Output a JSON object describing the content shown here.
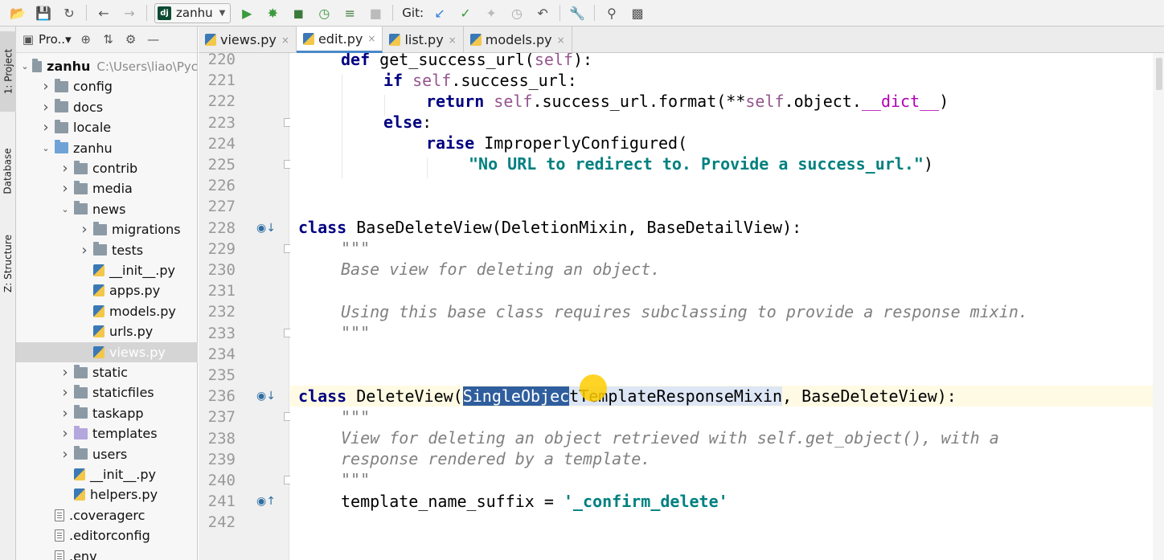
{
  "toolbar": {
    "run_config": "zanhu",
    "run_config_icon": "dj",
    "git_label": "Git:"
  },
  "left_tool_windows": [
    "1: Project",
    "Database",
    "Z: Structure"
  ],
  "project_panel": {
    "title": "Pro..▾",
    "tree": [
      {
        "label": "zanhu",
        "path": "C:\\Users\\liao\\Pyc",
        "type": "folder",
        "expanded": true,
        "bold": true
      },
      {
        "label": "config",
        "type": "folder",
        "expanded": false
      },
      {
        "label": "docs",
        "type": "folder",
        "expanded": false
      },
      {
        "label": "locale",
        "type": "folder",
        "expanded": false
      },
      {
        "label": "zanhu",
        "type": "folder-blue",
        "expanded": true
      },
      {
        "label": "contrib",
        "type": "folder",
        "expanded": false
      },
      {
        "label": "media",
        "type": "folder",
        "expanded": false
      },
      {
        "label": "news",
        "type": "folder",
        "expanded": true
      },
      {
        "label": "migrations",
        "type": "folder",
        "expanded": false
      },
      {
        "label": "tests",
        "type": "folder",
        "expanded": false
      },
      {
        "label": "__init__.py",
        "type": "py"
      },
      {
        "label": "apps.py",
        "type": "py"
      },
      {
        "label": "models.py",
        "type": "py"
      },
      {
        "label": "urls.py",
        "type": "py"
      },
      {
        "label": "views.py",
        "type": "py",
        "selected": true
      },
      {
        "label": "static",
        "type": "folder",
        "expanded": false
      },
      {
        "label": "staticfiles",
        "type": "folder",
        "expanded": false
      },
      {
        "label": "taskapp",
        "type": "folder",
        "expanded": false
      },
      {
        "label": "templates",
        "type": "folder-purple",
        "expanded": false
      },
      {
        "label": "users",
        "type": "folder",
        "expanded": false
      },
      {
        "label": "__init__.py",
        "type": "py"
      },
      {
        "label": "helpers.py",
        "type": "py"
      },
      {
        "label": ".coveragerc",
        "type": "cfg"
      },
      {
        "label": ".editorconfig",
        "type": "cfg"
      },
      {
        "label": ".env",
        "type": "cfg"
      }
    ]
  },
  "tabs": [
    {
      "label": "views.py",
      "active": false
    },
    {
      "label": "edit.py",
      "active": true
    },
    {
      "label": "list.py",
      "active": false
    },
    {
      "label": "models.py",
      "active": false
    }
  ],
  "editor": {
    "line_numbers": [
      "220",
      "221",
      "222",
      "223",
      "224",
      "225",
      "226",
      "227",
      "228",
      "229",
      "230",
      "231",
      "232",
      "233",
      "234",
      "235",
      "236",
      "237",
      "238",
      "239",
      "240",
      "241",
      "242"
    ],
    "code": {
      "l220_kw": "def",
      "l220_rest": " get_success_url(",
      "l220_self": "self",
      "l220_end": "):",
      "l221_kw": "if",
      "l221_self": "self",
      "l221_rest": ".success_url:",
      "l222_kw": "return",
      "l222_self": "self",
      "l222_mid": ".success_url.format(**",
      "l222_self2": "self",
      "l222_mid2": ".object.",
      "l222_dunder": "__dict__",
      "l222_end": ")",
      "l223_kw": "else",
      "l223_end": ":",
      "l224_kw": "raise",
      "l224_rest": " ImproperlyConfigured(",
      "l225_str": "\"No URL to redirect to. Provide a success_url.\"",
      "l225_end": ")",
      "l228_kw": "class",
      "l228_rest": " BaseDeleteView(DeletionMixin, BaseDetailView):",
      "l229": "\"\"\"",
      "l230": "Base view for deleting an object.",
      "l232": "Using this base class requires subclassing to provide a response mixin.",
      "l233": "\"\"\"",
      "l236_kw": "class",
      "l236_pre": " DeleteView(",
      "l236_sel": "SingleObjec",
      "l236_hl": "tTemplateResponseMixin",
      "l236_end": ", BaseDeleteView):",
      "l237": "\"\"\"",
      "l238": "View for deleting an object retrieved with self.get_object(), with a",
      "l239": "response rendered by a template.",
      "l240": "\"\"\"",
      "l241_pre": "template_name_suffix = ",
      "l241_str": "'_confirm_delete'"
    }
  }
}
